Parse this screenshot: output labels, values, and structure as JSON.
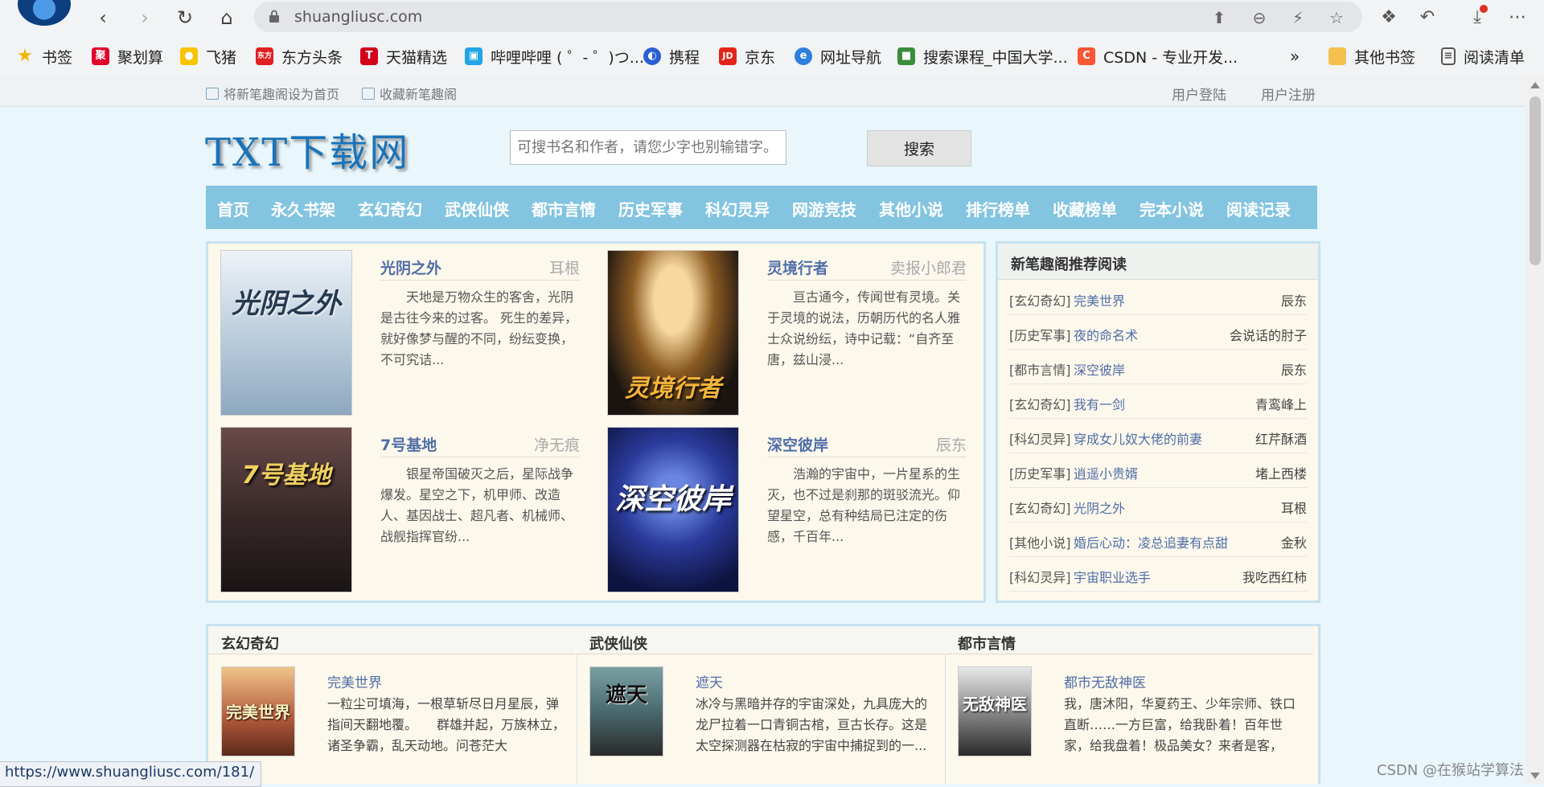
{
  "browser": {
    "url": "shuangliusc.com",
    "bookmarks": [
      "书签",
      "聚划算",
      "飞猪",
      "东方头条",
      "天猫精选",
      "哔哩哔哩 ( ゜- ゜)つ...",
      "携程",
      "京东",
      "网址导航",
      "搜索课程_中国大学...",
      "CSDN - 专业开发..."
    ],
    "bookmark_more": "»",
    "other_bookmarks": "其他书签",
    "reading_list": "阅读清单",
    "status_url": "https://www.shuangliusc.com/181/",
    "icon_colors": {
      "juhuasuan": "#e0002a",
      "feizhu": "#f8c400",
      "dongfang": "#e02020",
      "tianmao": "#d4001a",
      "bilibili": "#23a5e6",
      "xiecheng": "#2a5fd1",
      "jingdong": "#e1251b",
      "wangzhi": "#2d7fe0",
      "kecheng": "#3a8d3a",
      "csdn": "#fc5531"
    }
  },
  "topbar": {
    "set_home": "将新笔趣阁设为首页",
    "bookmark_site": "收藏新笔趣阁",
    "login": "用户登陆",
    "register": "用户注册"
  },
  "header": {
    "logo": "TXT下载网",
    "search_placeholder": "可搜书名和作者，请您少字也别输错字。",
    "search_button": "搜索"
  },
  "nav": [
    "首页",
    "永久书架",
    "玄幻奇幻",
    "武侠仙侠",
    "都市言情",
    "历史军事",
    "科幻灵异",
    "网游竞技",
    "其他小说",
    "排行榜单",
    "收藏榜单",
    "完本小说",
    "阅读记录"
  ],
  "featured": [
    {
      "title": "光阴之外",
      "author": "耳根",
      "cover_text": "光阴之外",
      "desc": "天地是万物众生的客舍，光阴是古往今来的过客。 死生的差异，就好像梦与醒的不同，纷纭变换，不可究诘...",
      "color": "#c9d9e6"
    },
    {
      "title": "灵境行者",
      "author": "卖报小郎君",
      "cover_text": "灵境行者",
      "desc": "亘古通今，传闻世有灵境。关于灵境的说法，历朝历代的名人雅士众说纷纭，诗中记载：“自齐至唐，兹山浸...",
      "color": "#2a2418"
    },
    {
      "title": "7号基地",
      "author": "净无痕",
      "cover_text": "7号基地",
      "desc": "银星帝国破灭之后，星际战争爆发。星空之下，机甲师、改造人、基因战士、超凡者、机械师、战舰指挥官纷...",
      "color": "#3a2a2a"
    },
    {
      "title": "深空彼岸",
      "author": "辰东",
      "cover_text": "深空彼岸",
      "desc": "浩瀚的宇宙中，一片星系的生灭，也不过是刹那的斑驳流光。仰望星空，总有种结局已注定的伤感，千百年...",
      "color": "#1c2a6e"
    }
  ],
  "recommend": {
    "title": "新笔趣阁推荐阅读",
    "items": [
      {
        "cat": "[玄幻奇幻]",
        "book": "完美世界",
        "author": "辰东"
      },
      {
        "cat": "[历史军事]",
        "book": "夜的命名术",
        "author": "会说话的肘子"
      },
      {
        "cat": "[都市言情]",
        "book": "深空彼岸",
        "author": "辰东"
      },
      {
        "cat": "[玄幻奇幻]",
        "book": "我有一剑",
        "author": "青鸾峰上"
      },
      {
        "cat": "[科幻灵异]",
        "book": "穿成女儿奴大佬的前妻",
        "author": "红芹酥酒"
      },
      {
        "cat": "[历史军事]",
        "book": "逍遥小贵婿",
        "author": "堵上西楼"
      },
      {
        "cat": "[玄幻奇幻]",
        "book": "光阴之外",
        "author": "耳根"
      },
      {
        "cat": "[其他小说]",
        "book": "婚后心动：凌总追妻有点甜",
        "author": "金秋"
      },
      {
        "cat": "[科幻灵异]",
        "book": "宇宙职业选手",
        "author": "我吃西红柿"
      }
    ]
  },
  "sections": [
    {
      "title": "玄幻奇幻",
      "book": "完美世界",
      "cover_text": "完美世界",
      "desc": "一粒尘可填海，一根草斩尽日月星辰，弹指间天翻地覆。　　群雄并起，万族林立，诸圣争霸，乱天动地。问苍茫大",
      "color": "#b0573a"
    },
    {
      "title": "武侠仙侠",
      "book": "遮天",
      "cover_text": "遮天",
      "desc": "冰冷与黑暗并存的宇宙深处，九具庞大的龙尸拉着一口青铜古棺，亘古长存。这是太空探测器在枯寂的宇宙中捕捉到的一...",
      "color": "#4a6a6e"
    },
    {
      "title": "都市言情",
      "book": "都市无敌神医",
      "cover_text": "无敌神医",
      "desc": "我，唐沐阳，华夏药王、少年宗师、铁口直断……一方巨富，给我卧着！百年世家，给我盘着！极品美女？来者是客，",
      "color": "#2a2a2a"
    }
  ],
  "watermark": "CSDN @在猴站学算法"
}
